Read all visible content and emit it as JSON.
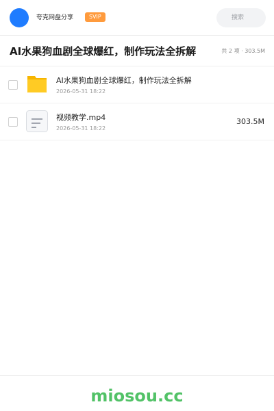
{
  "header": {
    "share_label": "夸克网盘分享",
    "svip_label": "SVIP",
    "search_placeholder": "搜索",
    "brand_color": "#1f7cff",
    "svip_color": "#ff9b3d"
  },
  "share": {
    "title": "AI水果狗血剧全球爆红，制作玩法全拆解",
    "meta": "共 2 项 · 303.5M"
  },
  "files": [
    {
      "name": "AI水果狗血剧全球爆红，制作玩法全拆解",
      "date": "2026-05-31 18:22",
      "size": "",
      "icon": "folder-icon"
    },
    {
      "name": "视频教学.mp4",
      "date": "2026-05-31 18:22",
      "size": "303.5M",
      "icon": "document-icon"
    }
  ],
  "footer": {
    "watermark": "miosou.cc",
    "watermark_color": "#52c267"
  }
}
